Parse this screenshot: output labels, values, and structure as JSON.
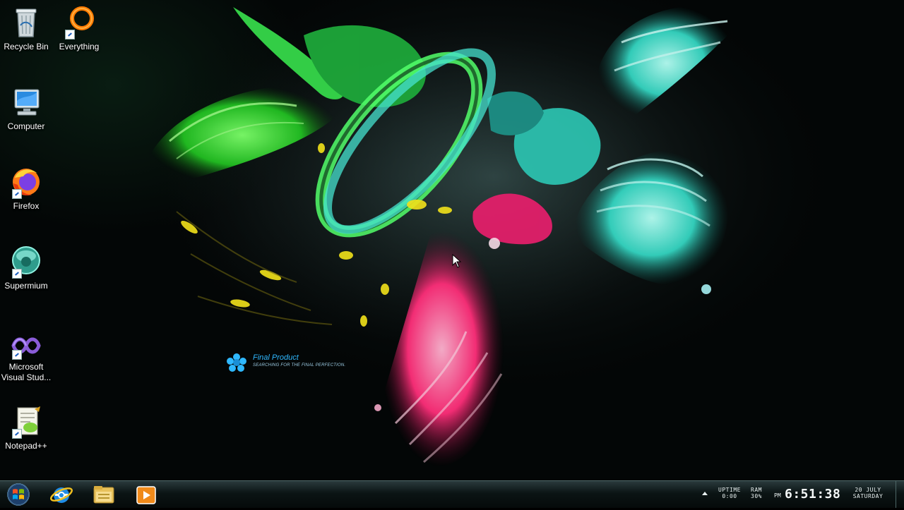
{
  "desktop": {
    "icons": [
      {
        "label": "Recycle Bin",
        "icon": "recycle-bin-icon"
      },
      {
        "label": "Everything",
        "icon": "everything-search-icon"
      },
      {
        "label": "Computer",
        "icon": "computer-icon"
      },
      {
        "label": "Firefox",
        "icon": "firefox-icon"
      },
      {
        "label": "Supermium",
        "icon": "supermium-icon"
      },
      {
        "label": "Microsoft Visual Stud...",
        "icon": "visual-studio-icon"
      },
      {
        "label": "Notepad++",
        "icon": "notepad-plus-plus-icon"
      }
    ],
    "wallpaper": {
      "brand_title": "Final Product",
      "brand_subtitle": "SEARCHING FOR THE FINAL PERFECTION."
    }
  },
  "taskbar": {
    "start": {
      "icon": "windows-start-orb-icon"
    },
    "pinned": [
      {
        "icon": "internet-explorer-icon"
      },
      {
        "icon": "file-explorer-icon"
      },
      {
        "icon": "media-player-icon"
      }
    ],
    "tray": {
      "expand_icon": "tray-up-arrow-icon",
      "uptime_label": "UPTIME",
      "uptime_value": "0:00",
      "ram_label": "RAM",
      "ram_value": "30%",
      "ampm": "PM",
      "time": "6:51:38",
      "date": "20 JULY",
      "weekday": "SATURDAY"
    }
  },
  "colors": {
    "green": "#3cff3c",
    "teal": "#3fe6d0",
    "pink": "#ff2f7a",
    "yellow": "#f2e21a",
    "brand_blue": "#2fb8ff"
  }
}
